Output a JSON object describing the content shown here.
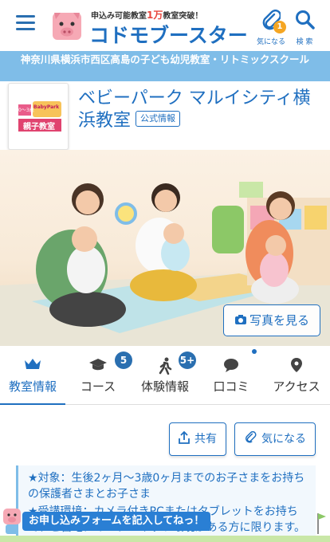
{
  "header": {
    "tagline_prefix": "申込み可能教室",
    "tagline_count": "1万",
    "tagline_suffix": "教室突破！",
    "brand": "コドモブースター",
    "favorites_label": "気になる",
    "favorites_count": "1",
    "search_label": "検 索"
  },
  "location": "神奈川県横浜市西区高島の子ども幼児教室・リトミックスクール",
  "school": {
    "name": "ベビーパーク マルイシティ横浜教室",
    "official_badge": "公式情報",
    "logo_text_top": "0〜3歳",
    "logo_text_brand": "BabyPark",
    "logo_text_bottom": "親子教室"
  },
  "photo": {
    "button_label": "写真を見る"
  },
  "tabs": [
    {
      "label": "教室情報",
      "active": true
    },
    {
      "label": "コース",
      "badge": "5"
    },
    {
      "label": "体験情報",
      "badge": "5+"
    },
    {
      "label": "口コミ"
    },
    {
      "label": "アクセス"
    }
  ],
  "actions": {
    "share_label": "共有",
    "favorite_label": "気になる"
  },
  "info": {
    "line1": "★対象：生後2ヶ月〜3歳0ヶ月までのお子さまをお持ちの保護者さまとお子さま",
    "line2": "★受講環境：カメラ付きPCまたはタブレットをお持ちで、ご自宅にインターネット環境がある方に限ります。"
  },
  "cta": {
    "label": "お申し込みフォームを記入してねっ！"
  },
  "colors": {
    "brand_blue": "#1f6fc0",
    "location_bar": "#7fbde8",
    "badge_orange": "#f5a623",
    "cta_blue": "#2a7fd4"
  }
}
